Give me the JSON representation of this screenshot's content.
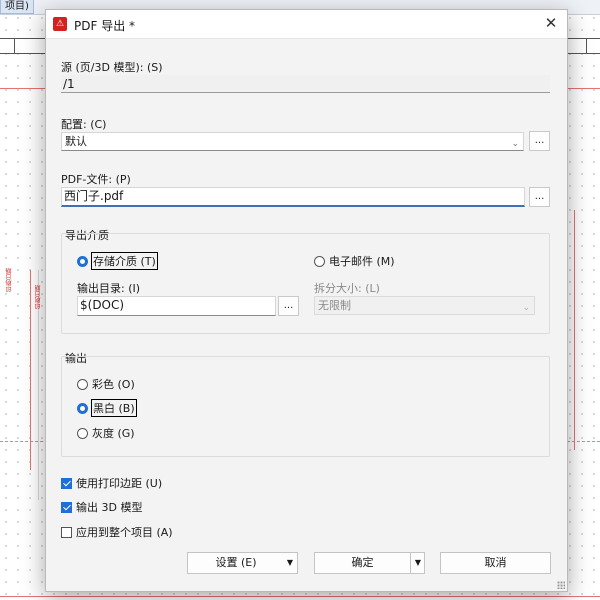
{
  "background": {
    "menu_label": "项目)",
    "vertical_texts": [
      "印刷日期",
      "印刷日期"
    ]
  },
  "dialog": {
    "title": "PDF 导出 *",
    "icons": {
      "app": "pdf-app-icon",
      "close": "close-icon"
    },
    "close_glyph": "✕",
    "source": {
      "label": "源 (页/3D 模型): (S)",
      "value": "/1"
    },
    "config": {
      "label": "配置: (C)",
      "value": "默认",
      "browse": "..."
    },
    "pdf_file": {
      "label": "PDF-文件: (P)",
      "value": "西门子.pdf",
      "browse": "..."
    },
    "medium": {
      "title": "导出介质",
      "storage": {
        "label": "存储介质 (T)",
        "selected": true
      },
      "email": {
        "label": "电子邮件 (M)",
        "selected": false
      },
      "output_dir": {
        "label": "输出目录: (I)",
        "value": "$(DOC)",
        "browse": "..."
      },
      "split_size": {
        "label": "拆分大小: (L)",
        "value": "无限制",
        "enabled": false
      }
    },
    "output": {
      "title": "输出",
      "options": [
        {
          "label": "彩色 (O)",
          "selected": false
        },
        {
          "label": "黑白 (B)",
          "selected": true
        },
        {
          "label": "灰度 (G)",
          "selected": false
        }
      ]
    },
    "checks": [
      {
        "label": "使用打印边距 (U)",
        "checked": true
      },
      {
        "label": "输出 3D 模型",
        "checked": true
      },
      {
        "label": "应用到整个项目 (A)",
        "checked": false
      }
    ],
    "buttons": {
      "settings": "设置 (E)",
      "ok": "确定",
      "cancel": "取消"
    },
    "colors": {
      "accent": "#1f6fd6",
      "app_icon": "#d32020"
    }
  }
}
